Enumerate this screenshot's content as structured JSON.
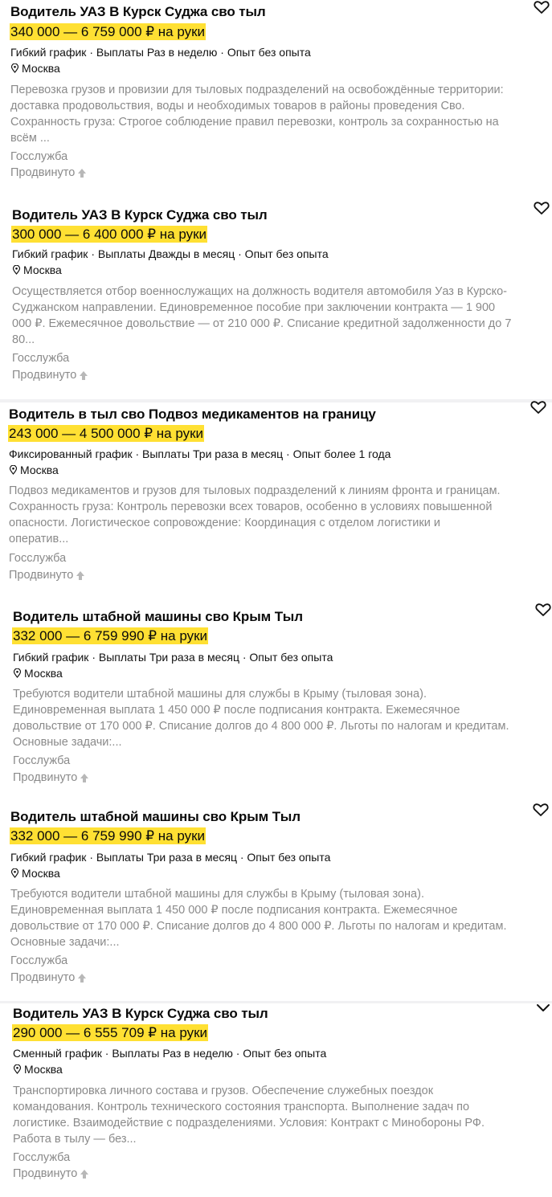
{
  "vacancies": [
    {
      "title": "Водитель УАЗ В Курск Суджа сво тыл",
      "salary": "340 000 — 6 759 000 ₽ на руки",
      "meta": "Гибкий график · Выплаты Раз в неделю · Опыт без опыта",
      "location": "Москва",
      "desc1": "Перевозка грузов и провизии для тыловых подразделений на освобождённые территории:",
      "desc2": "доставка продовольствия, воды и необходимых товаров в районы проведения Сво.",
      "desc3": "Сохранность груза: Строгое соблюдение правил перевозки, контроль за сохранностью на",
      "desc4": "всём ...",
      "tag": "Госслужба",
      "promo": "Продвинуто"
    },
    {
      "title": "Водитель УАЗ В Курск Суджа сво тыл",
      "salary": "300 000 — 6 400 000 ₽ на руки",
      "meta": "Гибкий график · Выплаты Дважды в месяц · Опыт без опыта",
      "location": "Москва",
      "desc1": "Осуществляется отбор военнослужащих на должность водителя автомобиля Уаз в Курско-",
      "desc2": "Суджанском направлении. Единовременное пособие при заключении контракта — 1 900",
      "desc3": "000 ₽. Ежемесячное довольствие — от 210 000 ₽. Списание кредитной задолженности до 7",
      "desc4": "80...",
      "tag": "Госслужба",
      "promo": "Продвинуто"
    },
    {
      "title": "Водитель в тыл сво Подвоз медикаментов на границу",
      "salary": "243 000 — 4 500 000 ₽ на руки",
      "meta": "Фиксированный график · Выплаты Три раза в месяц · Опыт более 1 года",
      "location": "Москва",
      "desc1": "Подвоз медикаментов и грузов для тыловых подразделений к линиям фронта и границам.",
      "desc2": "Сохранность груза: Контроль перевозки всех товаров, особенно в условиях повышенной",
      "desc3": "опасности. Логистическое сопровождение: Координация с отделом логистики и",
      "desc4": "оператив...",
      "tag": "Госслужба",
      "promo": "Продвинуто"
    },
    {
      "title": "Водитель штабной машины сво Крым Тыл",
      "salary": "332 000 — 6 759 990 ₽ на руки",
      "meta": "Гибкий график · Выплаты Три раза в месяц · Опыт без опыта",
      "location": "Москва",
      "desc1": "Требуются водители штабной машины для службы в Крыму (тыловая зона).",
      "desc2": "Единовременная выплата 1 450 000 ₽ после подписания контракта. Ежемесячное",
      "desc3": "довольствие от 170 000 ₽. Списание долгов до 4 800 000 ₽. Льготы по налогам и кредитам.",
      "desc4": "Основные задачи:...",
      "tag": "Госслужба",
      "promo": "Продвинуто"
    },
    {
      "title": "Водитель штабной машины сво Крым Тыл",
      "salary": "332 000 — 6 759 990 ₽ на руки",
      "meta": "Гибкий график · Выплаты Три раза в месяц · Опыт без опыта",
      "location": "Москва",
      "desc1": "Требуются водители штабной машины для службы в Крыму (тыловая зона).",
      "desc2": "Единовременная выплата 1 450 000 ₽ после подписания контракта. Ежемесячное",
      "desc3": "довольствие от 170 000 ₽. Списание долгов до 4 800 000 ₽. Льготы по налогам и кредитам.",
      "desc4": "Основные задачи:...",
      "tag": "Госслужба",
      "promo": "Продвинуто"
    },
    {
      "title": "Водитель УАЗ В Курск Суджа сво тыл",
      "salary": "290 000 — 6 555 709 ₽ на руки",
      "meta": "Сменный график · Выплаты Раз в неделю · Опыт без опыта",
      "location": "Москва",
      "desc1": "Транспортировка личного состава и грузов. Обеспечение служебных поездок",
      "desc2": "командования. Контроль технического состояния транспорта. Выполнение задач по",
      "desc3": "логистике. Взаимодействие с подразделениями. Условия: Контракт с Минобороны РФ.",
      "desc4": "Работа в тылу — без...",
      "tag": "Госслужба",
      "promo": "Продвинуто"
    }
  ],
  "colors": {
    "salary_highlight": "#ffe033",
    "muted_text": "#8a8a8a",
    "promo_arrow": "#b8b8b8"
  },
  "icons": {
    "favorite": "heart-icon",
    "location": "map-pin-icon",
    "promoted": "arrow-up-icon",
    "collapse": "chevron-down-icon"
  }
}
